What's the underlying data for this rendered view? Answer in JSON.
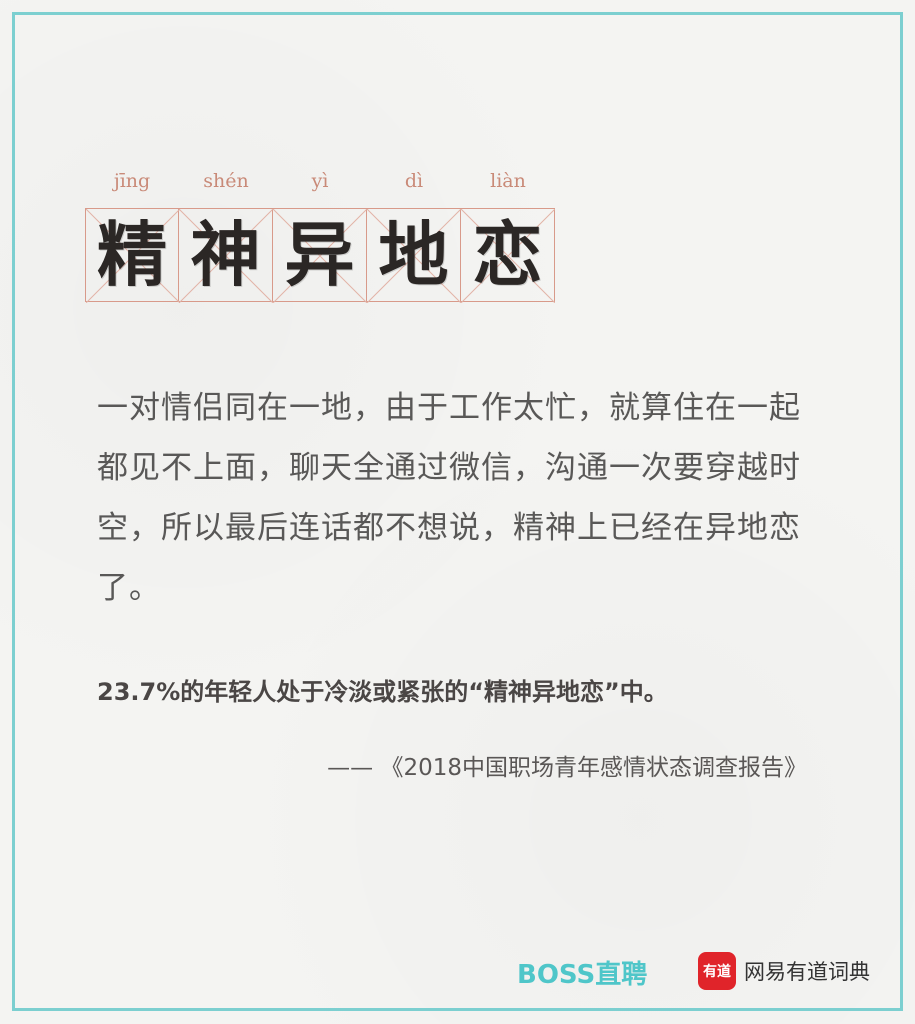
{
  "title": {
    "pinyin": [
      "jīng",
      "shén",
      "yì",
      "dì",
      "liàn"
    ],
    "characters": [
      "精",
      "神",
      "异",
      "地",
      "恋"
    ]
  },
  "body": "一对情侣同在一地，由于工作太忙，就算住在一起都见不上面，聊天全通过微信，沟通一次要穿越时空，所以最后连话都不想说，精神上已经在异地恋了。",
  "stat": "23.7%的年轻人处于冷淡或紧张的“精神异地恋”中。",
  "source": "—— 《2018中国职场青年感情状态调查报告》",
  "footer": {
    "boss_brand": "BOSS直聘",
    "youdao_logo_text": "有道",
    "youdao_brand": "网易有道词典"
  },
  "colors": {
    "frame": "#7ccfd0",
    "grid": "#d89a8a",
    "pinyin": "#c98a78",
    "boss": "#4fc6c9",
    "youdao": "#e0242a"
  }
}
